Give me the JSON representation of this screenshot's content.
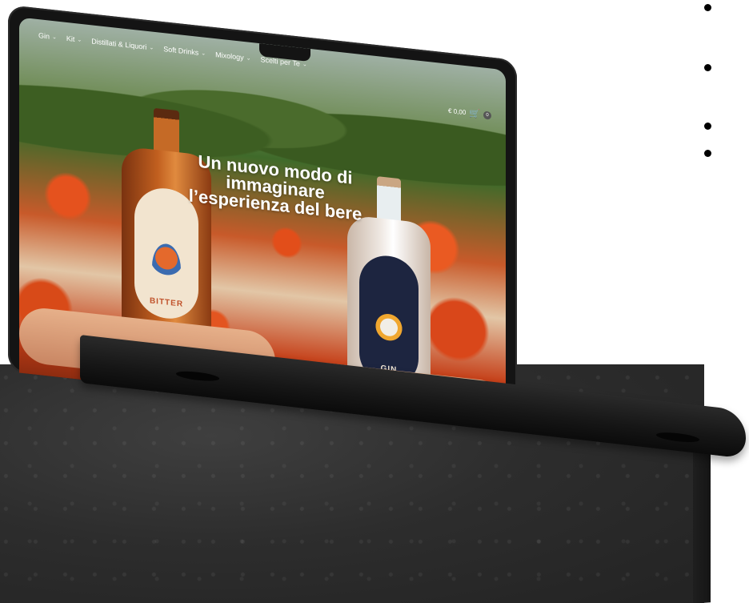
{
  "nav": {
    "items": [
      {
        "label": "Gin"
      },
      {
        "label": "Kit"
      },
      {
        "label": "Distillati & Liquori"
      },
      {
        "label": "Soft Drinks"
      },
      {
        "label": "Mixology"
      },
      {
        "label": "Scelti per Te"
      }
    ],
    "chevron_icon": "chevron-down-icon"
  },
  "cart": {
    "total": "€ 0,00",
    "count": "0",
    "icon": "cart-icon"
  },
  "hero": {
    "headline_line1": "Un nuovo modo di",
    "headline_line2": "immaginare",
    "headline_line3": "l’esperienza del bere"
  },
  "products": [
    {
      "label": "BITTER"
    },
    {
      "label": "GIN"
    }
  ],
  "colors": {
    "nav_text": "#ffffff",
    "laptop_frame": "#141414",
    "concrete": "#2d2d2d"
  }
}
